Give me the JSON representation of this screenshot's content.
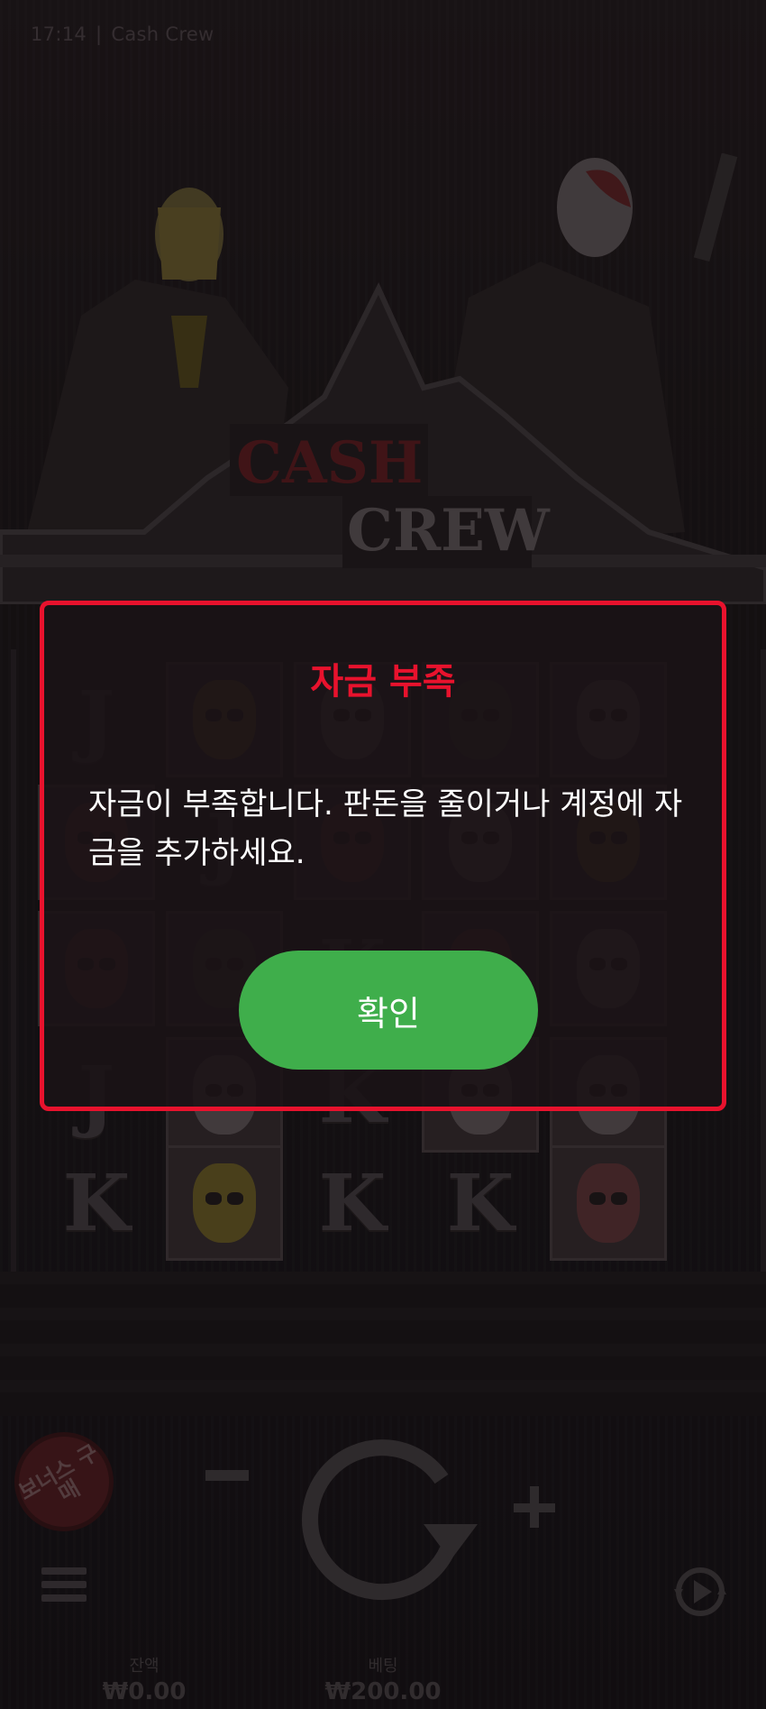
{
  "status_bar": {
    "time": "17:14",
    "separator": "|",
    "app_name": "Cash Crew"
  },
  "logo": {
    "line1": "CASH",
    "line2": "CREW"
  },
  "reel_symbols": [
    [
      "J",
      "skull-gold",
      "skull",
      "skull-green",
      "skull"
    ],
    [
      "skull-red",
      "J",
      "skull-red",
      "skull",
      "skull-gold"
    ],
    [
      "skull-red",
      "skull-green",
      "K",
      "skull-red",
      "skull"
    ],
    [
      "J",
      "skull",
      "K",
      "skull",
      "skull"
    ],
    [
      "K",
      "skull-gold",
      "K",
      "K",
      "skull-red"
    ]
  ],
  "controls": {
    "buy_bonus_label": "보너스 구매",
    "balance_label": "잔액",
    "balance_value": "₩0.00",
    "bet_label": "베팅",
    "bet_value": "₩200.00"
  },
  "modal": {
    "title": "자금 부족",
    "message": "자금이 부족합니다. 판돈을 줄이거나 계정에 자금을 추가하세요.",
    "confirm_label": "확인"
  },
  "colors": {
    "alert_red": "#e8122d",
    "confirm_green": "#3fae4b",
    "background": "#141012"
  }
}
